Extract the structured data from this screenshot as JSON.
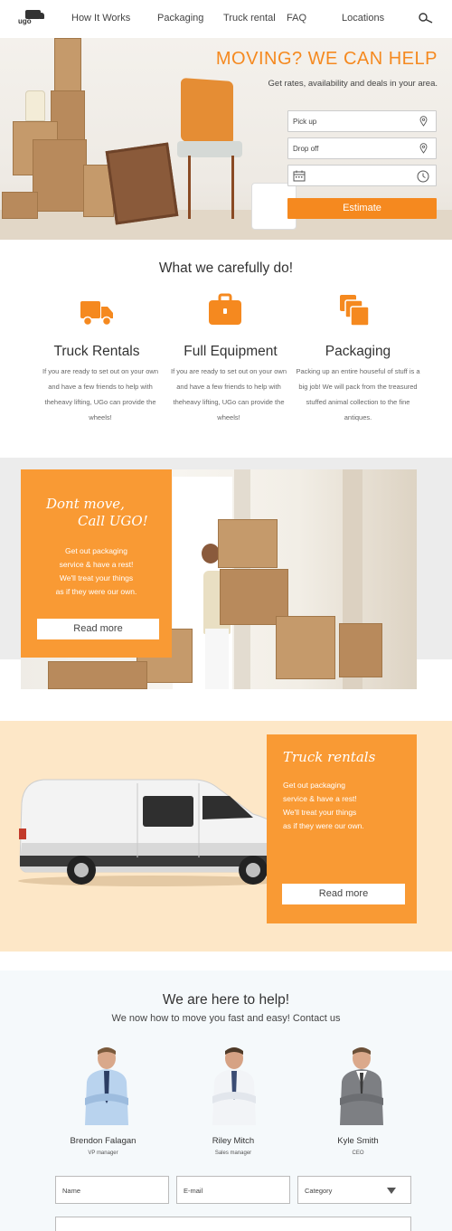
{
  "nav": {
    "logo": "ugo",
    "links": [
      "How It Works",
      "Packaging",
      "Truck rental",
      "FAQ",
      "Locations"
    ]
  },
  "hero": {
    "title": "MOVING? WE CAN HELP",
    "subtitle": "Get rates, availability and deals in your area.",
    "pickup_placeholder": "Pick up",
    "dropoff_placeholder": "Drop off",
    "date_value": "",
    "estimate_label": "Estimate"
  },
  "services": {
    "title": "What we carefully do!",
    "items": [
      {
        "icon": "truck-icon",
        "title": "Truck Rentals",
        "text": "If you are ready to set out on your own and have a few friends to help with theheavy lifting, UGo can provide the wheels!"
      },
      {
        "icon": "toolbox-icon",
        "title": "Full Equipment",
        "text": "If you are ready to set out on your own and have a few friends to help with theheavy lifting, UGo can provide the wheels!"
      },
      {
        "icon": "stacked-boxes-icon",
        "title": "Packaging",
        "text": "Packing up an entire houseful of stuff is a big job! We will pack from the treasured stuffed animal collection to the fine antiques."
      }
    ]
  },
  "promo_move": {
    "heading_line1": "Dont move,",
    "heading_line2": "Call UGO!",
    "body": [
      "Get out packaging",
      "service & have a rest!",
      "We'll treat your things",
      "as if they were our own."
    ],
    "button": "Read more"
  },
  "promo_truck": {
    "heading": "Truck rentals",
    "body": [
      "Get out packaging",
      "service & have a rest!",
      "We'll treat your things",
      "as if they were our own."
    ],
    "button": "Read more"
  },
  "team": {
    "title": "We are here to help!",
    "subtitle": "We now how to move you fast and easy! Contact us",
    "members": [
      {
        "name": "Brendon Falagan",
        "role": "VP manager"
      },
      {
        "name": "Riley Mitch",
        "role": "Sales manager"
      },
      {
        "name": "Kyle Smith",
        "role": "CEO"
      }
    ]
  },
  "contact_form": {
    "name_placeholder": "Name",
    "email_placeholder": "E-mail",
    "category_label": "Category",
    "message_value": ""
  },
  "colors": {
    "accent": "#f5891f",
    "card": "#f99a34",
    "peach_band": "#fde7c7",
    "grey_band": "#ececec"
  }
}
